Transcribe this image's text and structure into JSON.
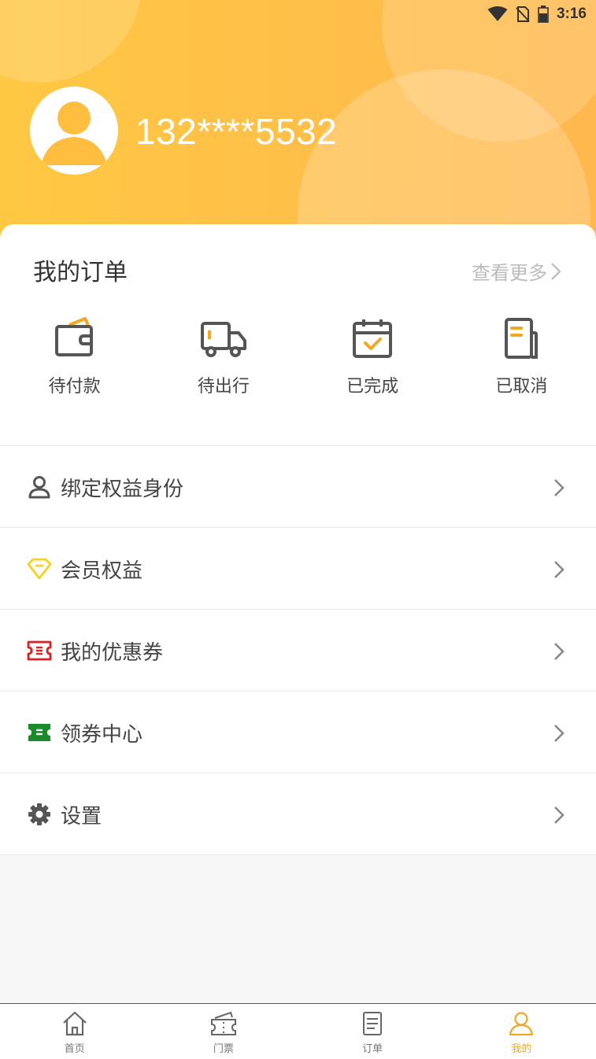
{
  "status_bar": {
    "time": "3:16"
  },
  "profile": {
    "phone": "132****5532"
  },
  "orders": {
    "title": "我的订单",
    "view_more": "查看更多",
    "items": [
      {
        "label": "待付款",
        "icon": "wallet-icon"
      },
      {
        "label": "待出行",
        "icon": "truck-icon"
      },
      {
        "label": "已完成",
        "icon": "calendar-check-icon"
      },
      {
        "label": "已取消",
        "icon": "document-icon"
      }
    ]
  },
  "menu": {
    "items": [
      {
        "label": "绑定权益身份",
        "icon": "user-icon",
        "icon_color": "#555555"
      },
      {
        "label": "会员权益",
        "icon": "diamond-icon",
        "icon_color": "#f5d21c"
      },
      {
        "label": "我的优惠券",
        "icon": "coupon-icon",
        "icon_color": "#e02020"
      },
      {
        "label": "领券中心",
        "icon": "ticket-icon",
        "icon_color": "#1a8a2b"
      },
      {
        "label": "设置",
        "icon": "gear-icon",
        "icon_color": "#555555"
      }
    ]
  },
  "bottom_nav": {
    "items": [
      {
        "label": "首页",
        "icon": "home-icon"
      },
      {
        "label": "门票",
        "icon": "ticket-icon"
      },
      {
        "label": "订单",
        "icon": "order-list-icon"
      },
      {
        "label": "我的",
        "icon": "profile-icon",
        "active": true
      }
    ]
  },
  "colors": {
    "accent": "#f5a623",
    "header_gradient_start": "#ffc843",
    "header_gradient_end": "#ffb84e"
  }
}
